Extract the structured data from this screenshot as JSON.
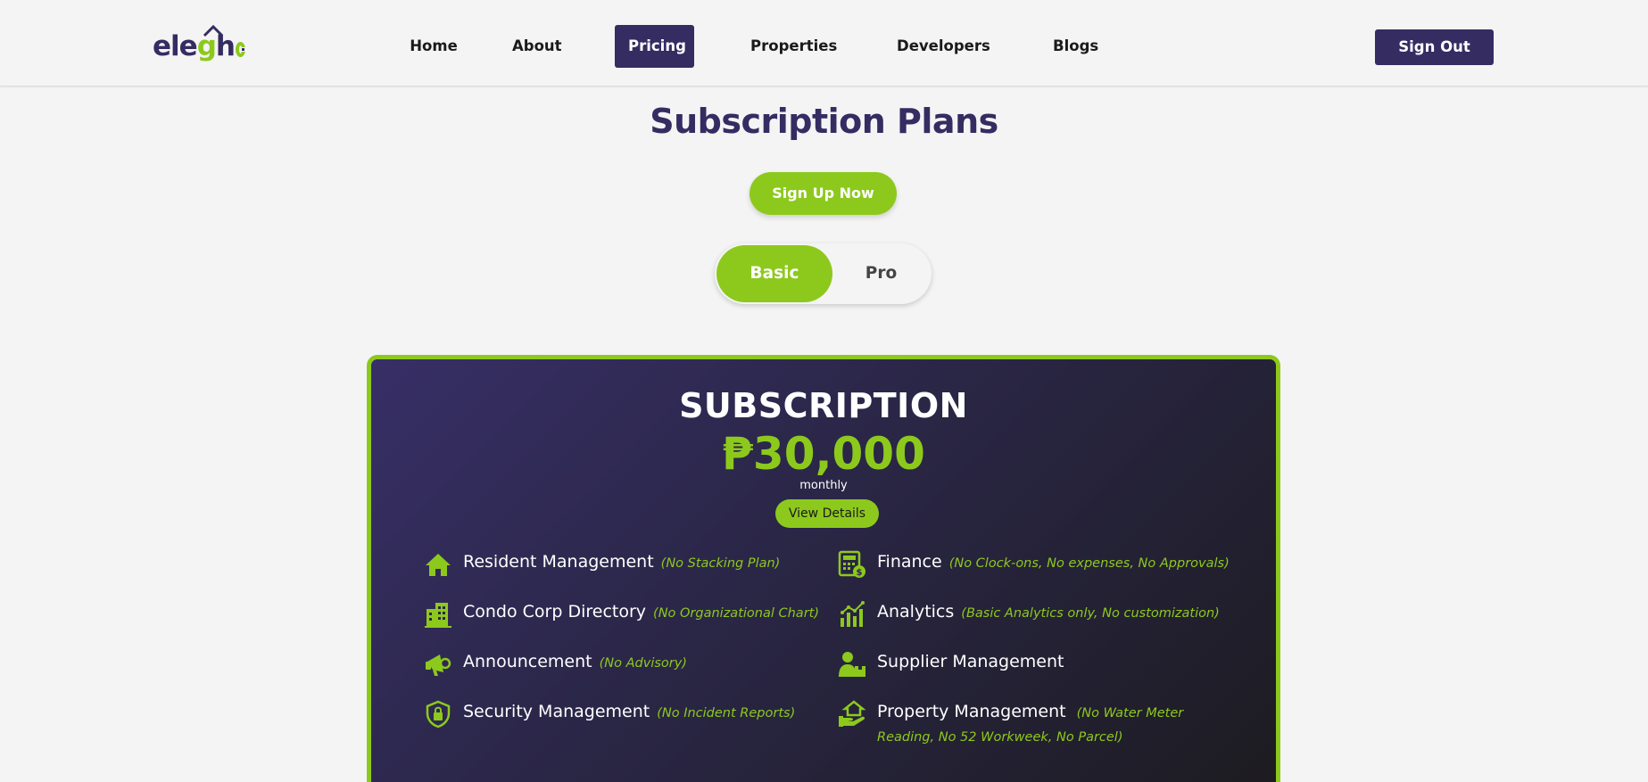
{
  "brand": {
    "logo_ele": "ele",
    "logo_g": "g",
    "logo_h": "h",
    "primary_color": "#352c62",
    "accent_color": "#8dc91d"
  },
  "nav": {
    "links": [
      {
        "label": "Home"
      },
      {
        "label": "About"
      },
      {
        "label": "Pricing",
        "active": true
      },
      {
        "label": "Properties"
      },
      {
        "label": "Developers"
      },
      {
        "label": "Blogs"
      }
    ],
    "sign_out": "Sign Out"
  },
  "page": {
    "title": "Subscription Plans",
    "signup_label": "Sign Up Now",
    "toggle": {
      "basic": "Basic",
      "pro": "Pro",
      "selected": "Basic"
    }
  },
  "plan": {
    "title": "SUBSCRIPTION",
    "price": "₱30,000",
    "period": "monthly",
    "details_label": "View Details",
    "features": [
      {
        "icon": "house-icon",
        "name": "Resident Management",
        "note": "(No Stacking Plan)"
      },
      {
        "icon": "calculator-icon",
        "name": "Finance",
        "note": "(No Clock-ons, No expenses, No Approvals)"
      },
      {
        "icon": "building-icon",
        "name": "Condo Corp Directory",
        "note": "(No Organizational Chart)"
      },
      {
        "icon": "analytics-icon",
        "name": "Analytics",
        "note": "(Basic Analytics only, No customization)"
      },
      {
        "icon": "megaphone-icon",
        "name": "Announcement",
        "note": "(No Advisory)"
      },
      {
        "icon": "supplier-icon",
        "name": "Supplier Management",
        "note": ""
      },
      {
        "icon": "shield-lock-icon",
        "name": "Security Management",
        "note": "(No Incident Reports)"
      },
      {
        "icon": "hand-house-icon",
        "name": "Property Management",
        "note": "(No Water Meter Reading, No 52 Workweek, No Parcel)"
      }
    ]
  }
}
